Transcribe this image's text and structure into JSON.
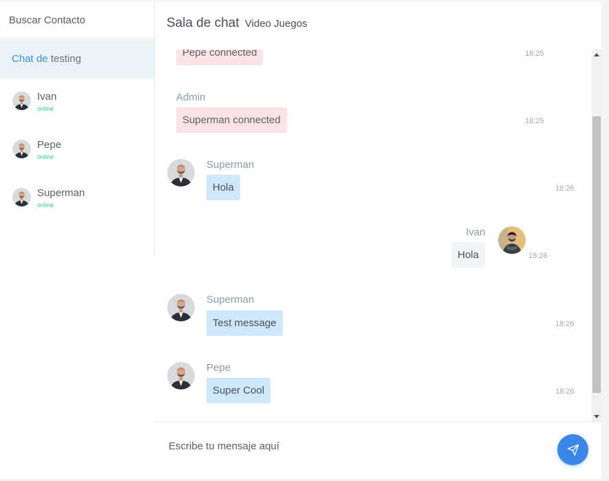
{
  "sidebar": {
    "search_label": "Buscar Contacto",
    "room": {
      "prefix": "Chat de",
      "name": "testing"
    },
    "contacts": [
      {
        "name": "Ivan",
        "status": "online",
        "icon": "user-avatar-icon"
      },
      {
        "name": "Pepe",
        "status": "online",
        "icon": "user-avatar-icon"
      },
      {
        "name": "Superman",
        "status": "online",
        "icon": "user-avatar-icon"
      }
    ]
  },
  "header": {
    "title": "Sala de chat",
    "subtitle": "Video Juegos"
  },
  "messages": [
    {
      "type": "system",
      "author": "",
      "text": "Pepe connected",
      "time": "18:25"
    },
    {
      "type": "system",
      "author": "Admin",
      "text": "Superman connected",
      "time": "18:25"
    },
    {
      "type": "incoming",
      "author": "Superman",
      "text": "Hola",
      "time": "18:26"
    },
    {
      "type": "outgoing",
      "author": "Ivan",
      "text": "Hola",
      "time": "18:26"
    },
    {
      "type": "incoming",
      "author": "Superman",
      "text": "Test message",
      "time": "18:26"
    },
    {
      "type": "incoming",
      "author": "Pepe",
      "text": "Super Cool",
      "time": "18:26"
    }
  ],
  "composer": {
    "placeholder": "Escribe tu mensaje aquí",
    "send_icon": "paper-plane-icon"
  },
  "colors": {
    "accent": "#3b87e8",
    "online": "#2ecc8a",
    "system_bubble": "#fbe3e7",
    "incoming_bubble": "#cfe8fb",
    "outgoing_bubble": "#f3f4f5",
    "room_active": "#ecf3f6"
  }
}
